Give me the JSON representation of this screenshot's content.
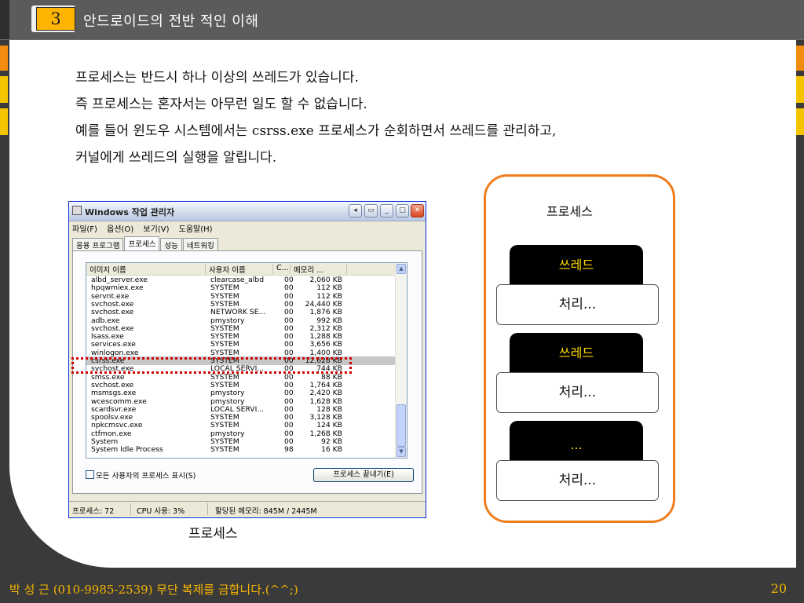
{
  "header": {
    "slide_number": "3",
    "title": "안드로이드의 전반 적인 이해"
  },
  "body": {
    "lines": [
      "프로세스는 반드시 하나 이상의 쓰레드가 있습니다.",
      "즉 프로세스는 혼자서는 아무런 일도 할 수 없습니다.",
      "예를 들어 윈도우 시스템에서는 csrss.exe 프로세스가 순회하면서 쓰레드를 관리하고,",
      "커널에게 쓰레드의 실행을 알립니다."
    ]
  },
  "taskmgr": {
    "title": "Windows 작업 관리자",
    "menu": [
      "파일(F)",
      "옵션(O)",
      "보기(V)",
      "도움말(H)"
    ],
    "tabs": [
      "응용 프로그램",
      "프로세스",
      "성능",
      "네트워킹"
    ],
    "columns": [
      "이미지 이름",
      "사용자 이름",
      "C...",
      "메모리 ..."
    ],
    "rows": [
      [
        "albd_server.exe",
        "clearcase_albd",
        "00",
        "2,060 KB"
      ],
      [
        "hpqwmiex.exe",
        "SYSTEM",
        "00",
        "112 KB"
      ],
      [
        "servnt.exe",
        "SYSTEM",
        "00",
        "112 KB"
      ],
      [
        "svchost.exe",
        "SYSTEM",
        "00",
        "24,440 KB"
      ],
      [
        "svchost.exe",
        "NETWORK SE...",
        "00",
        "1,876 KB"
      ],
      [
        "adb.exe",
        "pmystory",
        "00",
        "992 KB"
      ],
      [
        "svchost.exe",
        "SYSTEM",
        "00",
        "2,312 KB"
      ],
      [
        "lsass.exe",
        "SYSTEM",
        "00",
        "1,288 KB"
      ],
      [
        "services.exe",
        "SYSTEM",
        "00",
        "3,656 KB"
      ],
      [
        "winlogon.exe",
        "SYSTEM",
        "00",
        "1,400 KB"
      ],
      [
        "csrss.exe",
        "SYSTEM",
        "00",
        "12,628 KB"
      ],
      [
        "svchost.exe",
        "LOCAL SERVI...",
        "00",
        "744 KB"
      ],
      [
        "smss.exe",
        "SYSTEM",
        "00",
        "88 KB"
      ],
      [
        "svchost.exe",
        "SYSTEM",
        "00",
        "1,764 KB"
      ],
      [
        "msmsgs.exe",
        "pmystory",
        "00",
        "2,420 KB"
      ],
      [
        "wcescomm.exe",
        "pmystory",
        "00",
        "1,628 KB"
      ],
      [
        "scardsvr.exe",
        "LOCAL SERVI...",
        "00",
        "128 KB"
      ],
      [
        "spoolsv.exe",
        "SYSTEM",
        "00",
        "3,128 KB"
      ],
      [
        "npkcmsvc.exe",
        "SYSTEM",
        "00",
        "124 KB"
      ],
      [
        "ctfmon.exe",
        "pmystory",
        "00",
        "1,268 KB"
      ],
      [
        "System",
        "SYSTEM",
        "00",
        "92 KB"
      ],
      [
        "System Idle Process",
        "SYSTEM",
        "98",
        "16 KB"
      ]
    ],
    "show_all_label": "모든 사용자의 프로세스 표시(S)",
    "end_process_label": "프로세스 끝내기(E)",
    "status": {
      "processes": "프로세스: 72",
      "cpu": "CPU 사용: 3%",
      "memory": "할당된 메모리: 845M / 2445M"
    }
  },
  "caption": "프로세스",
  "diagram": {
    "process_label": "프로세스",
    "threads": [
      {
        "head": "쓰레드",
        "work": "처리..."
      },
      {
        "head": "쓰레드",
        "work": "처리..."
      },
      {
        "head": "...",
        "work": "처리..."
      }
    ]
  },
  "footer": {
    "left": "박 성 근 (010-9985-2539)  무단 복제를 금합니다.(^^;)",
    "page": "20"
  },
  "colors": {
    "accent_orange": "#f07d1c",
    "accent_yellow": "#f5b500",
    "thread_text": "#ffd700",
    "highlight_red": "#d00000"
  }
}
